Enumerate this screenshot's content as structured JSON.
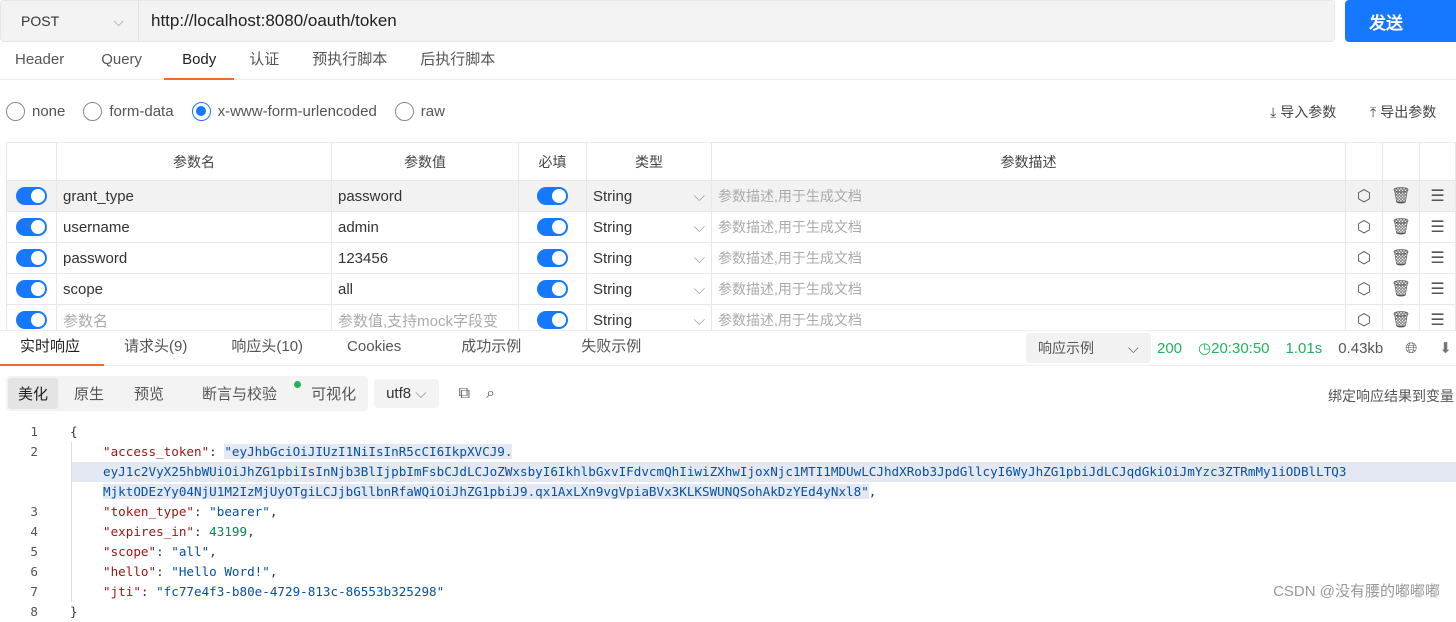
{
  "request": {
    "method": "POST",
    "url": "http://localhost:8080/oauth/token",
    "send_label": "发送"
  },
  "tabs": [
    "Header",
    "Query",
    "Body",
    "认证",
    "预执行脚本",
    "后执行脚本"
  ],
  "body_types": [
    "none",
    "form-data",
    "x-www-form-urlencoded",
    "raw"
  ],
  "selected_body_type": "x-www-form-urlencoded",
  "import_label": "导入参数",
  "export_label": "导出参数",
  "table": {
    "headers": [
      "参数名",
      "参数值",
      "必填",
      "类型",
      "参数描述"
    ],
    "desc_placeholder": "参数描述,用于生成文档",
    "rows": [
      {
        "name": "grant_type",
        "value": "password",
        "type": "String"
      },
      {
        "name": "username",
        "value": "admin",
        "type": "String"
      },
      {
        "name": "password",
        "value": "123456",
        "type": "String"
      },
      {
        "name": "scope",
        "value": "all",
        "type": "String"
      }
    ],
    "new_row": {
      "name_placeholder": "参数名",
      "value_placeholder": "参数值,支持mock字段变",
      "type": "String"
    }
  },
  "response": {
    "tabs": [
      "实时响应",
      "请求头(9)",
      "响应头(10)",
      "Cookies",
      "成功示例",
      "失败示例"
    ],
    "example_label": "响应示例",
    "status": "200",
    "time": "20:30:50",
    "duration": "1.01s",
    "size": "0.43kb",
    "views": [
      "美化",
      "原生",
      "预览",
      "断言与校验",
      "可视化"
    ],
    "encoding": "utf8",
    "bind_label": "绑定响应结果到变量",
    "lines": {
      "l1": "{",
      "k_access": "\"access_token\"",
      "tok1": "\"eyJhbGciOiJIUzI1NiIsInR5cCI6IkpXVCJ9.",
      "tok2": "eyJ1c2VyX25hbWUiOiJhZG1pbiIsInNjb3BlIjpbImFsbCJdLCJoZWxsbyI6IkhlbGxvIFdvcmQhIiwiZXhwIjoxNjc1MTI1MDUwLCJhdXRob3JpdGllcyI6WyJhZG1pbiJdLCJqdGkiOiJmYzc3ZTRmMy1iODBlLTQ3",
      "tok3": "MjktODEzYy04NjU1M2IzMjUyOTgiLCJjbGllbnRfaWQiOiJhZG1pbiJ9.qx1AxLXn9vgVpiaBVx3KLKSWUNQSohAkDzYEd4yNxl8\"",
      "k_type": "\"token_type\"",
      "v_type": "\"bearer\"",
      "k_exp": "\"expires_in\"",
      "v_exp": "43199",
      "k_scope": "\"scope\"",
      "v_scope": "\"all\"",
      "k_hello": "\"hello\"",
      "v_hello": "\"Hello Word!\"",
      "k_jti": "\"jti\"",
      "v_jti": "\"fc77e4f3-b80e-4729-813c-86553b325298\"",
      "l8": "}"
    }
  },
  "watermark": "CSDN @没有腰的嘟嘟嘟"
}
